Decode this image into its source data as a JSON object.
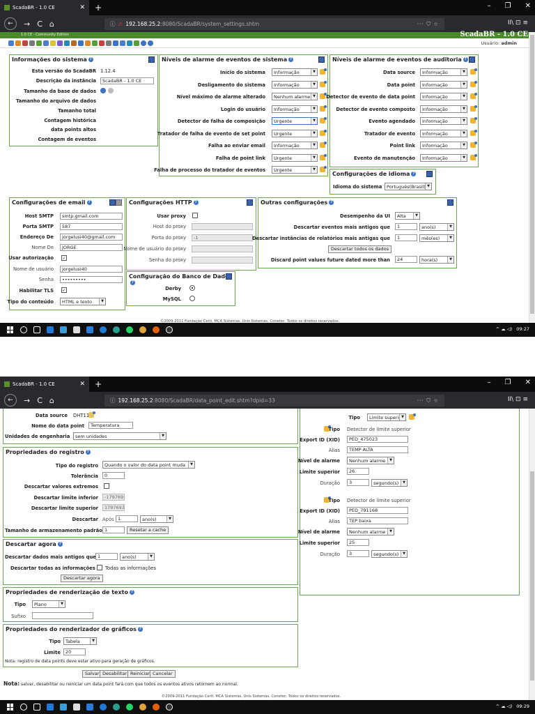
{
  "browser": {
    "tab_title": "ScadaBR - 1.0 CE",
    "new_tab": "+",
    "window_controls": [
      "–",
      "❐",
      "✕"
    ],
    "nav": {
      "back": "←",
      "forward": "→",
      "reload": "C",
      "home": "⌂"
    },
    "url_host_1": "192.168.25.2",
    "url_rest_1": ":8080/ScadaBR/system_settings.shtm",
    "url_host_2": "192.168.25.2",
    "url_rest_2": ":8080/ScadaBR/data_point_edit.shtm?dpid=33",
    "url_actions": "··· ⛉ ☆",
    "toolbar_right": "II\\ ⊡ ≡"
  },
  "app": {
    "brand": "ScadaBR - 1.0 CE",
    "subtitle": "1.0 CE - Community Edition",
    "user_label": "Usuário:",
    "user_name": "admin"
  },
  "system_info": {
    "title": "Informações do sistema",
    "version_label": "Esta versão do ScadaBR",
    "version_value": "1.12.4",
    "instance_label": "Descrição da instância",
    "instance_value": "ScadaBR - 1.0 CE",
    "db_size_label": "Tamanho da base de dados",
    "file_size_label": "Tamanho do arquivo de dados",
    "total_size_label": "Tamanho total",
    "history_count_label": "Contagem histórica",
    "top_points_label": "data points altos",
    "event_count_label": "Contagem de eventos"
  },
  "sys_alarm": {
    "title": "Níveis de alarme de eventos de sistema",
    "rows": [
      {
        "label": "Início do sistema",
        "value": "Informação"
      },
      {
        "label": "Desligamento do sistema",
        "value": "Informação"
      },
      {
        "label": "Nível máximo de alarme alterado",
        "value": "Nenhum alarme"
      },
      {
        "label": "Login do usuário",
        "value": "Informação"
      },
      {
        "label": "Detector de falha de composição",
        "value": "Urgente"
      },
      {
        "label": "Tratador de falha de evento de set point",
        "value": "Urgente"
      },
      {
        "label": "Falha ao enviar email",
        "value": "Informação"
      },
      {
        "label": "Falha de point link",
        "value": "Urgente"
      },
      {
        "label": "Falha de processo do tratador de eventos",
        "value": "Urgente"
      }
    ]
  },
  "audit_alarm": {
    "title": "Níveis de alarme de eventos de auditoria",
    "rows": [
      {
        "label": "Data source",
        "value": "Informação"
      },
      {
        "label": "Data point",
        "value": "Informação"
      },
      {
        "label": "Detector de evento de data point",
        "value": "Informação"
      },
      {
        "label": "Detector de evento composto",
        "value": "Informação"
      },
      {
        "label": "Evento agendado",
        "value": "Informação"
      },
      {
        "label": "Tratador de evento",
        "value": "Informação"
      },
      {
        "label": "Point link",
        "value": "Informação"
      },
      {
        "label": "Evento de manutenção",
        "value": "Informação"
      }
    ]
  },
  "language": {
    "title": "Configurações de idioma",
    "label": "Idioma do sistema",
    "value": "Português(Brasil)"
  },
  "email": {
    "title": "Configurações de email",
    "smtp_host_label": "Host SMTP",
    "smtp_host_value": "smtp.gmail.com",
    "smtp_port_label": "Porta SMTP",
    "smtp_port_value": "587",
    "from_addr_label": "Endereço De",
    "from_addr_value": "jorgelusi40@gmail.com",
    "from_name_label": "Nome De",
    "from_name_value": "JORGE",
    "use_auth_label": "Usar autorização",
    "use_auth_mark": "✓",
    "username_label": "Nome de usuário",
    "username_value": "jorgelusi40",
    "password_label": "Senha",
    "password_value": "•••••••••",
    "tls_label": "Habilitar TLS",
    "tls_mark": "✓",
    "content_type_label": "Tipo do conteúdo",
    "content_type_value": "HTML e texto"
  },
  "http": {
    "title": "Configurações HTTP",
    "use_proxy_label": "Usar proxy",
    "proxy_host_label": "Host do proxy",
    "proxy_port_label": "Porta do proxy",
    "proxy_port_value": "-1",
    "proxy_user_label": "Nome de usuário do proxy",
    "proxy_pass_label": "Senha do proxy"
  },
  "database": {
    "title": "Configuração do Banco de Dados",
    "derby_label": "Derby",
    "mysql_label": "MySQL"
  },
  "other": {
    "title": "Outras configurações",
    "ui_perf_label": "Desempenho da UI",
    "ui_perf_value": "Alta",
    "purge_events_label": "Descartar eventos mais antigos que",
    "purge_events_num": "1",
    "purge_events_unit": "ano(s)",
    "purge_reports_label": "Descartar instâncias de relatórios mais antigas que",
    "purge_reports_num": "1",
    "purge_reports_unit": "mês(es)",
    "purge_all_button": "Descartar todos os dados",
    "future_label": "Discard point values future dated more than",
    "future_num": "24",
    "future_unit": "hora(s)"
  },
  "footer": {
    "text": "©2009-2011 Fundação Certi, MCA Sistemas, Unis Sistemas, Conetec. Todos os direitos reservados."
  },
  "taskbar": {
    "time_1": "09:27",
    "time_2": "09:29",
    "tray_icons": "^ ☁ ◁) "
  },
  "dp_edit": {
    "ds_label": "Data source",
    "ds_value": "DHT11",
    "name_label": "Nome do data point",
    "name_value": "Temperatura",
    "units_label": "Unidades de engenharia",
    "units_value": "sem unidades",
    "logging": {
      "title": "Propriedades do registro",
      "type_label": "Tipo do registro",
      "type_value": "Quando o valor do data point muda",
      "tolerance_label": "Tolerância",
      "tolerance_value": "0",
      "discard_extreme_label": "Descartar valores extremos",
      "discard_low_label": "Descartar limite inferior",
      "discard_low_value": "-1797693",
      "discard_high_label": "Descartar limite superior",
      "discard_high_value": "1797693",
      "purge_label": "Descartar",
      "purge_after": "Após",
      "purge_num": "1",
      "purge_unit": "ano(s)",
      "cache_label": "Tamanho de armazenamento padrão",
      "cache_value": "1",
      "cache_button": "Resetar a cache"
    },
    "purge_now": {
      "title": "Descartar agora",
      "older_label": "Descartar dados mais antigos que",
      "older_num": "1",
      "older_unit": "ano(s)",
      "all_label": "Descartar todas as informações",
      "all_check_label": "Todas as informações",
      "button": "Descartar agora"
    },
    "text_render": {
      "title": "Propriedades de renderização de texto",
      "type_label": "Tipo",
      "type_value": "Plano",
      "suffix_label": "Sufixo"
    },
    "chart_render": {
      "title": "Propriedades do renderizador de gráficos",
      "type_label": "Tipo",
      "type_value": "Tabela",
      "limit_label": "Limite",
      "limit_value": "20",
      "note": "Nota: registro de data points deve estar ativo para geração de gráficos."
    },
    "buttons": [
      "Salvar",
      "Desabilitar",
      "Reiniciar",
      "Cancelar"
    ],
    "bottom_note_bold": "Nota:",
    "bottom_note": " salvar, desabilitar ou reiniciar um data point fará com que todos os eventos ativos retornem ao normal.",
    "detectors": {
      "top_type_label": "Tipo",
      "top_type_value": "Limite superior",
      "items": [
        {
          "type_label": "Tipo",
          "type_value": "Detector de limite superior",
          "xid_label": "Export ID (XID)",
          "xid_value": "PED_475023",
          "alias_label": "Alias",
          "alias_value": "TEMP ALTA",
          "alarm_label": "Nível de alarme",
          "alarm_value": "Nenhum alarme",
          "limit_label": "Limite superior",
          "limit_value": "26",
          "duration_label": "Duração",
          "duration_num": "3",
          "duration_unit": "segundo(s)"
        },
        {
          "type_label": "Tipo",
          "type_value": "Detector de limite superior",
          "xid_label": "Export ID (XID)",
          "xid_value": "PED_791168",
          "alias_label": "Alias",
          "alias_value": "TEP baixa",
          "alarm_label": "Nível de alarme",
          "alarm_value": "Nenhum alarme",
          "limit_label": "Limite superior",
          "limit_value": "25",
          "duration_label": "Duração",
          "duration_num": "3",
          "duration_unit": "segundo(s)"
        }
      ]
    }
  }
}
